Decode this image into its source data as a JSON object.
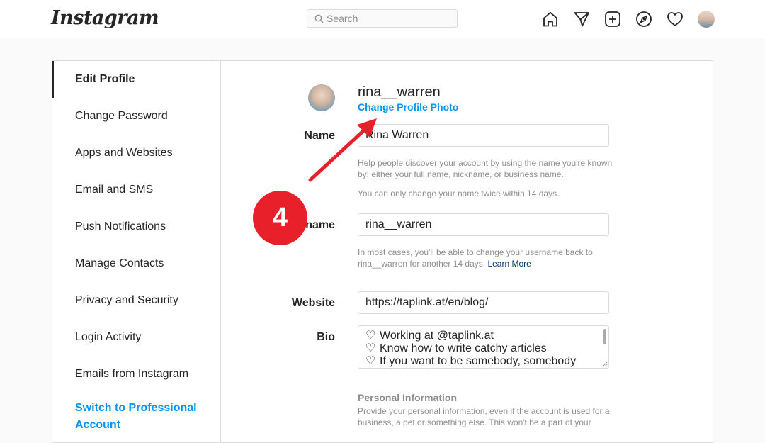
{
  "app": {
    "logo_text": "Instagram"
  },
  "header": {
    "search_placeholder": "Search",
    "icons": [
      "home-icon",
      "direct-icon",
      "new-post-icon",
      "explore-icon",
      "activity-heart-icon",
      "profile-avatar-icon"
    ]
  },
  "sidebar": {
    "items": [
      {
        "label": "Edit Profile",
        "active": true
      },
      {
        "label": "Change Password"
      },
      {
        "label": "Apps and Websites"
      },
      {
        "label": "Email and SMS"
      },
      {
        "label": "Push Notifications"
      },
      {
        "label": "Manage Contacts"
      },
      {
        "label": "Privacy and Security"
      },
      {
        "label": "Login Activity"
      },
      {
        "label": "Emails from Instagram"
      }
    ],
    "switch_professional": "Switch to Professional Account"
  },
  "profile": {
    "username": "rina__warren",
    "change_photo": "Change Profile Photo"
  },
  "form": {
    "name_label": "Name",
    "name_value": "Rina Warren",
    "name_help_1": "Help people discover your account by using the name you're known by: either your full name, nickname, or business name.",
    "name_help_2": "You can only change your name twice within 14 days.",
    "username_label": "Username",
    "username_value": "rina__warren",
    "username_help": "In most cases, you'll be able to change your username back to rina__warren for another 14 days.",
    "learn_more": "Learn More",
    "website_label": "Website",
    "website_value": "https://taplink.at/en/blog/",
    "bio_label": "Bio",
    "bio_lines": [
      "Working at @taplink.at",
      "Know how to write catchy articles",
      "If you want to be somebody, somebody"
    ],
    "bio_line_icon": "♡",
    "personal_info_title": "Personal Information",
    "personal_info_text": "Provide your personal information, even if the account is used for a business, a pet or something else. This won't be a part of your"
  },
  "annotation": {
    "step_number": "4",
    "color": "#e8202a"
  },
  "colors": {
    "link_blue": "#0095f6",
    "border": "#dbdbdb",
    "muted": "#8e8e8e"
  }
}
